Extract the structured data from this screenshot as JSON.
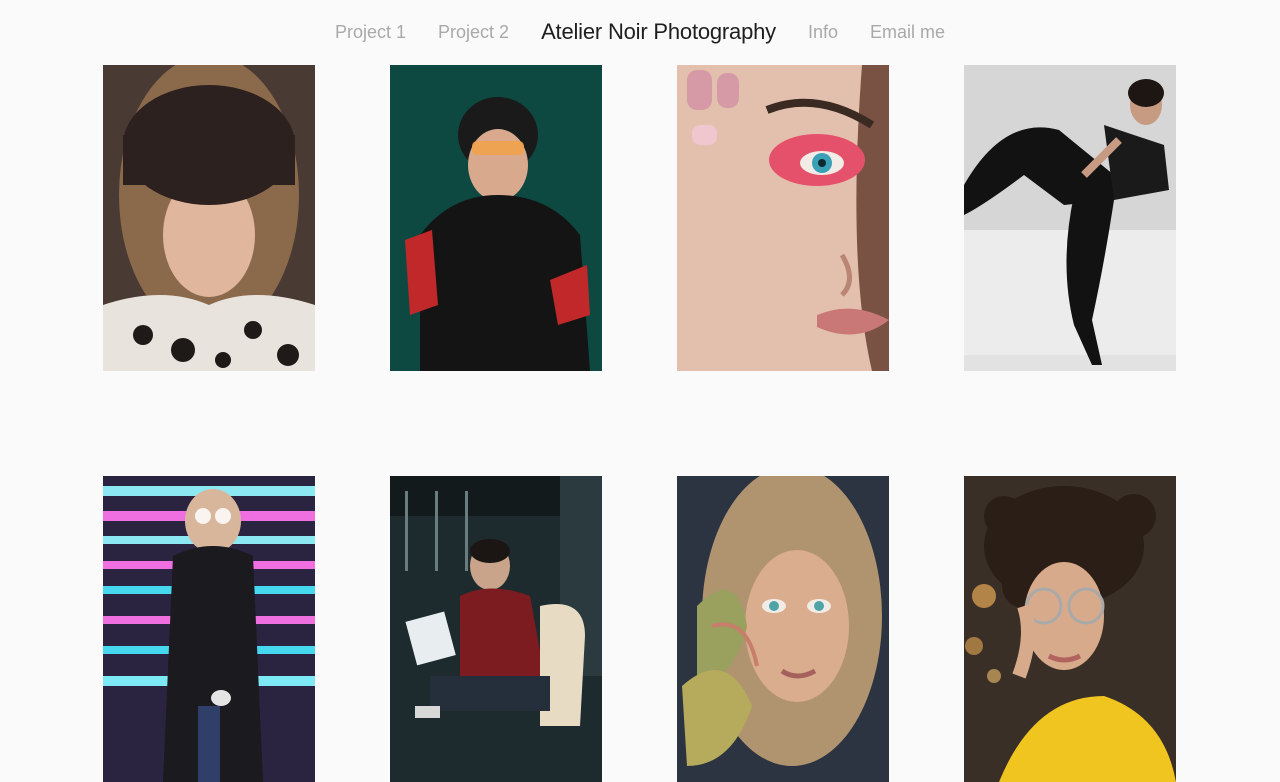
{
  "nav": {
    "left_links": [
      "Project 1",
      "Project 2"
    ],
    "brand": "Atelier Noir Photography",
    "right_links": [
      "Info",
      "Email me"
    ]
  },
  "gallery": {
    "rows": [
      [
        {
          "subject": "woman in fur hat and leopard scarf",
          "bg": "#4a3a34"
        },
        {
          "subject": "person in black sweater on green backdrop",
          "bg": "#0f5147"
        },
        {
          "subject": "close-up of face with pink eye makeup",
          "bg": "#caa08f"
        },
        {
          "subject": "model in black stockings on white set",
          "bg": "#d6d6d6"
        }
      ],
      [
        {
          "subject": "woman in neon lit stairway",
          "bg": "#2a2440"
        },
        {
          "subject": "man reading newspaper in dark room",
          "bg": "#1d2a2e"
        },
        {
          "subject": "woman with flower and light pattern",
          "bg": "#2b3440"
        },
        {
          "subject": "curly haired woman in yellow top",
          "bg": "#3a2f26"
        }
      ]
    ]
  }
}
